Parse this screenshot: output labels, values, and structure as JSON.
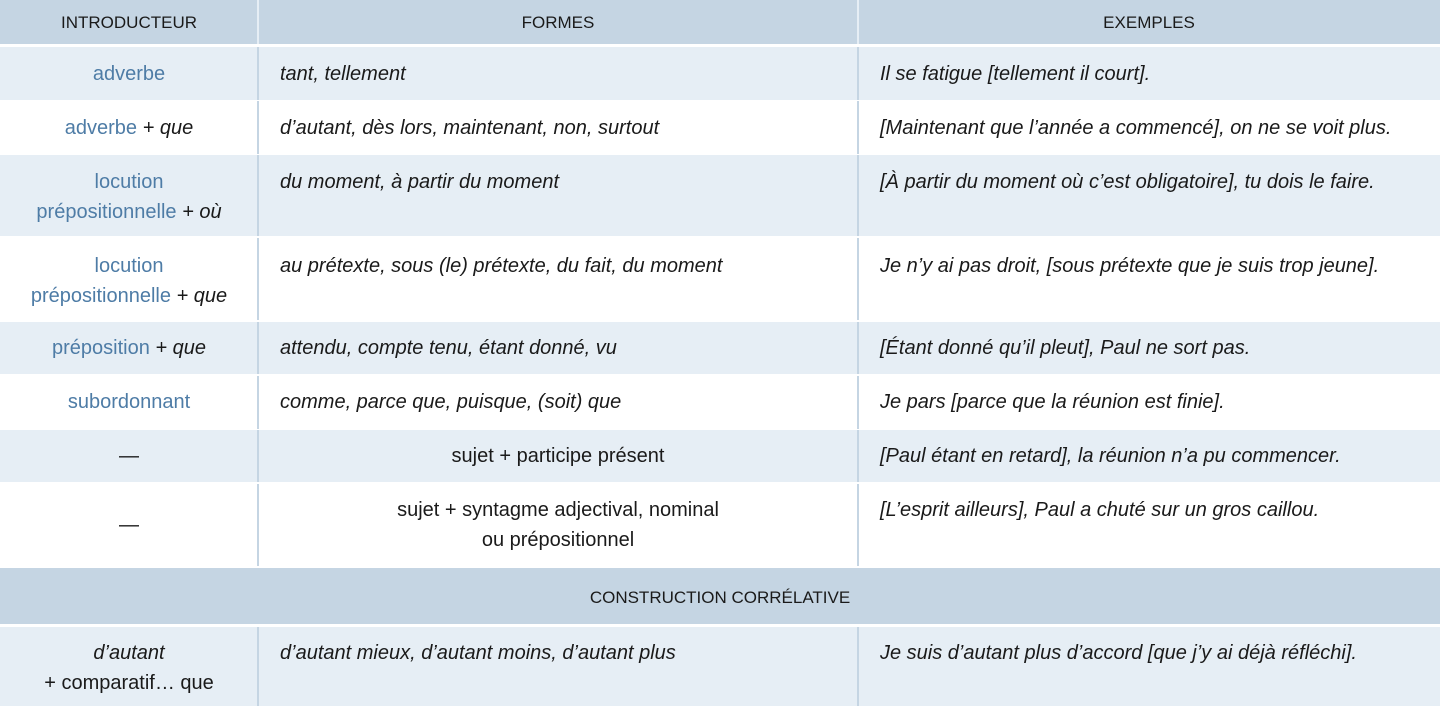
{
  "header": {
    "col1": "INTRODUCTEUR",
    "col2": "FORMES",
    "col3": "EXEMPLES"
  },
  "rows": [
    {
      "intro": [
        "adverbe"
      ],
      "formes": "tant, tellement",
      "exemple": "Il se fatigue [tellement il court]."
    },
    {
      "intro": [
        "adverbe",
        "+ que"
      ],
      "formes": "d’autant, dès lors, maintenant, non, surtout",
      "exemple": "[Maintenant que l’année a commencé], on ne se voit plus."
    },
    {
      "intro": [
        "locution",
        "prépositionnelle",
        "+ où"
      ],
      "formes": "du moment, à partir du moment",
      "exemple": "[À partir du moment où c’est obligatoire], tu dois le faire."
    },
    {
      "intro": [
        "locution",
        "prépositionnelle",
        "+ que"
      ],
      "formes": "au prétexte, sous (le) prétexte, du fait, du moment",
      "exemple": "Je n’y ai pas droit, [sous prétexte que je suis trop jeune]."
    },
    {
      "intro": [
        "préposition",
        "+ que"
      ],
      "formes": "attendu, compte tenu, étant donné, vu",
      "exemple": "[Étant donné qu’il pleut], Paul ne sort pas."
    },
    {
      "intro": [
        "subordonnant"
      ],
      "formes": "comme, parce que, puisque, (soit) que",
      "exemple": "Je pars [parce que la réunion est finie]."
    },
    {
      "intro": [
        "—"
      ],
      "formes": "sujet + participe présent",
      "exemple": "[Paul étant en retard], la réunion n’a pu commencer."
    },
    {
      "intro": [
        "—"
      ],
      "formes": [
        "sujet + syntagme adjectival, nominal",
        "ou prépositionnel"
      ],
      "exemple": "[L’esprit ailleurs], Paul a chuté sur un gros caillou."
    }
  ],
  "section_title": "CONSTRUCTION CORRÉLATIVE",
  "correlative": {
    "intro": [
      "d’autant",
      "+ comparatif… que"
    ],
    "formes": "d’autant mieux, d’autant moins, d’autant plus",
    "exemple": "Je suis d’autant plus d’accord [que j’y ai déjà réfléchi]."
  },
  "colors": {
    "header_bg": "#c5d5e3",
    "band_bg": "#e6eef5",
    "accent": "#4e7ca6"
  }
}
